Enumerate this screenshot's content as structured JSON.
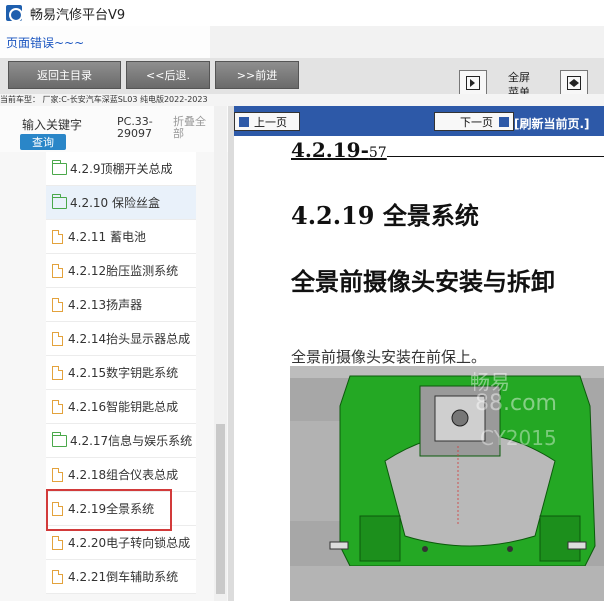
{
  "window": {
    "title": "畅易汽修平台V9",
    "error_text": "页面错误~~~"
  },
  "toolbar": {
    "home_label": "返回主目录",
    "back_label": "<<后退.",
    "forward_label": ">>前进",
    "fullscreen_label_line1": "全屏",
    "fullscreen_label_line2": "菜单"
  },
  "vehicle_info": "当前车型：  厂家:C-长安汽车深蓝SL03 纯电版2022-2023",
  "sidebar": {
    "keyword_label": "输入关键字",
    "query_button": "查询",
    "code_label": "PC.33-29097",
    "fold_label": "折叠全部",
    "items": [
      {
        "label": "4.2.9顶棚开关总成",
        "icon": "folder-icon",
        "selected": false
      },
      {
        "label": "4.2.10 保险丝盒",
        "icon": "folder-icon",
        "selected": true
      },
      {
        "label": "4.2.11 蓄电池",
        "icon": "page-icon",
        "selected": false
      },
      {
        "label": "4.2.12胎压监测系统",
        "icon": "page-icon",
        "selected": false
      },
      {
        "label": "4.2.13扬声器",
        "icon": "page-icon",
        "selected": false
      },
      {
        "label": "4.2.14抬头显示器总成",
        "icon": "page-icon",
        "selected": false
      },
      {
        "label": "4.2.15数字钥匙系统",
        "icon": "page-icon",
        "selected": false
      },
      {
        "label": "4.2.16智能钥匙总成",
        "icon": "page-icon",
        "selected": false
      },
      {
        "label": "4.2.17信息与娱乐系统",
        "icon": "folder-icon",
        "selected": false
      },
      {
        "label": "4.2.18组合仪表总成",
        "icon": "page-icon",
        "selected": false
      },
      {
        "label": "4.2.19全景系统",
        "icon": "page-icon",
        "selected": false
      },
      {
        "label": "4.2.20电子转向锁总成",
        "icon": "page-icon",
        "selected": false
      },
      {
        "label": "4.2.21倒车辅助系统",
        "icon": "page-icon",
        "selected": false
      }
    ]
  },
  "viewer": {
    "prev_label": "上一页",
    "next_label": "下一页",
    "refresh_label": "[刷新当前页.]",
    "section_number": "4.2.19-",
    "section_page": "57",
    "heading": "4.2.19 全景系统",
    "subheading": "全景前摄像头安装与拆卸",
    "paragraph": "全景前摄像头安装在前保上。",
    "watermark_lines": [
      "畅易",
      "88.com",
      "CY2015"
    ]
  },
  "colors": {
    "accent": "#2d59a8",
    "query_button": "#2a86c8",
    "highlight": "#d23a3a",
    "part_green": "#2bb12b"
  }
}
